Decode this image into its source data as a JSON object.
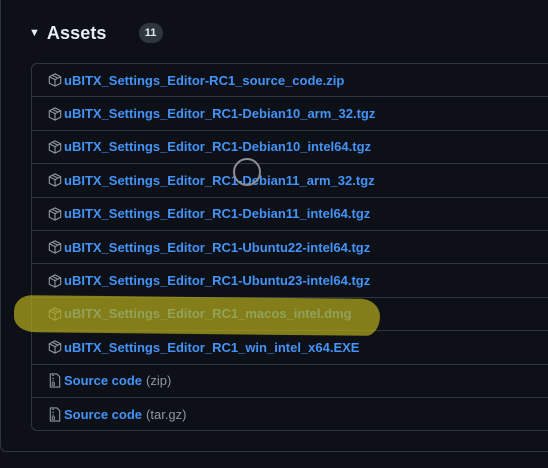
{
  "assets": {
    "title": "Assets",
    "count": "11",
    "files": [
      {
        "name": "uBITX_Settings_Editor-RC1_source_code.zip",
        "icon": "package-icon"
      },
      {
        "name": "uBITX_Settings_Editor_RC1-Debian10_arm_32.tgz",
        "icon": "package-icon"
      },
      {
        "name": "uBITX_Settings_Editor_RC1-Debian10_intel64.tgz",
        "icon": "package-icon"
      },
      {
        "name": "uBITX_Settings_Editor_RC1-Debian11_arm_32.tgz",
        "icon": "package-icon"
      },
      {
        "name": "uBITX_Settings_Editor_RC1-Debian11_intel64.tgz",
        "icon": "package-icon"
      },
      {
        "name": "uBITX_Settings_Editor_RC1-Ubuntu22-intel64.tgz",
        "icon": "package-icon"
      },
      {
        "name": "uBITX_Settings_Editor_RC1-Ubuntu23-intel64.tgz",
        "icon": "package-icon"
      },
      {
        "name": "uBITX_Settings_Editor_RC1_macos_intel.dmg",
        "icon": "package-icon"
      },
      {
        "name": "uBITX_Settings_Editor_RC1_win_intel_x64.EXE",
        "icon": "package-icon"
      }
    ],
    "source": [
      {
        "label": "Source code",
        "suffix": "(zip)",
        "icon": "file-zip-icon"
      },
      {
        "label": "Source code",
        "suffix": "(tar.gz)",
        "icon": "file-zip-icon"
      }
    ]
  },
  "colors": {
    "background": "#0d1117",
    "border": "#30363d",
    "link": "#4493f8",
    "muted": "#8d96a0",
    "text": "#e6edf3",
    "highlight": "#b2a81c"
  }
}
